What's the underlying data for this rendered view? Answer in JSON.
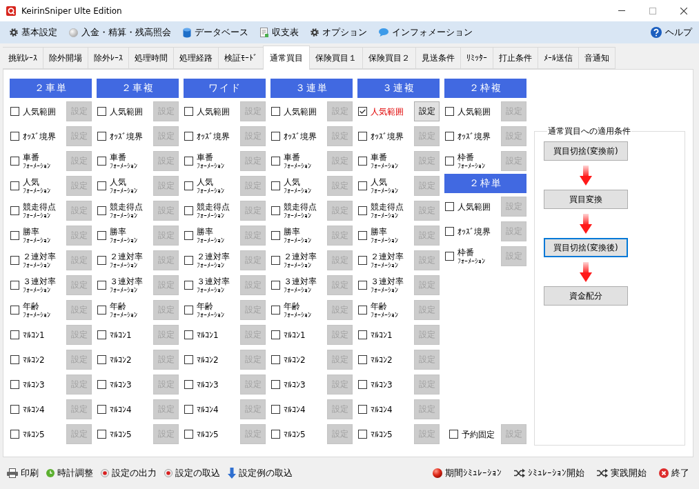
{
  "window": {
    "title": "KeirinSniper Ulte Edition"
  },
  "menu": [
    {
      "label": "基本設定"
    },
    {
      "label": "入金・精算・残高照会"
    },
    {
      "label": "データベース"
    },
    {
      "label": "収支表"
    },
    {
      "label": "オプション"
    },
    {
      "label": "インフォメーション"
    }
  ],
  "help": {
    "label": "ヘルプ"
  },
  "tabs": [
    {
      "label": "挑戦ﾚｰｽ",
      "selected": false
    },
    {
      "label": "除外開場",
      "selected": false
    },
    {
      "label": "除外ﾚｰｽ",
      "selected": false
    },
    {
      "label": "処理時間",
      "selected": false
    },
    {
      "label": "処理経路",
      "selected": false
    },
    {
      "label": "検証ﾓｰﾄﾞ",
      "selected": false
    },
    {
      "label": "通常買目",
      "selected": true
    },
    {
      "label": "保険買目１",
      "selected": false
    },
    {
      "label": "保険買目２",
      "selected": false
    },
    {
      "label": "見送条件",
      "selected": false
    },
    {
      "label": "ﾘﾐｯﾀｰ",
      "selected": false
    },
    {
      "label": "打止条件",
      "selected": false
    },
    {
      "label": "ﾒｰﾙ送信",
      "selected": false
    },
    {
      "label": "音通知",
      "selected": false
    }
  ],
  "columns": [
    {
      "sections": [
        {
          "header": "２車単",
          "rows": [
            {
              "label": "人気範囲",
              "checked": false,
              "button": "設定"
            },
            {
              "label": "ｵｯｽﾞ境界",
              "checked": false,
              "button": "設定"
            },
            {
              "label": "車番",
              "sublabel": "ﾌｫｰﾒｰｼｮﾝ",
              "checked": false,
              "button": "設定"
            },
            {
              "label": "人気",
              "sublabel": "ﾌｫｰﾒｰｼｮﾝ",
              "checked": false,
              "button": "設定"
            },
            {
              "label": "競走得点",
              "sublabel": "ﾌｫｰﾒｰｼｮﾝ",
              "checked": false,
              "button": "設定"
            },
            {
              "label": "勝率",
              "sublabel": "ﾌｫｰﾒｰｼｮﾝ",
              "checked": false,
              "button": "設定"
            },
            {
              "label": "２連対率",
              "sublabel": "ﾌｫｰﾒｰｼｮﾝ",
              "checked": false,
              "button": "設定"
            },
            {
              "label": "３連対率",
              "sublabel": "ﾌｫｰﾒｰｼｮﾝ",
              "checked": false,
              "button": "設定"
            },
            {
              "label": "年齢",
              "sublabel": "ﾌｫｰﾒｰｼｮﾝ",
              "checked": false,
              "button": "設定"
            },
            {
              "label": "ﾏﾙｺﾝ1",
              "checked": false,
              "button": "設定"
            },
            {
              "label": "ﾏﾙｺﾝ2",
              "checked": false,
              "button": "設定"
            },
            {
              "label": "ﾏﾙｺﾝ3",
              "checked": false,
              "button": "設定"
            },
            {
              "label": "ﾏﾙｺﾝ4",
              "checked": false,
              "button": "設定"
            },
            {
              "label": "ﾏﾙｺﾝ5",
              "checked": false,
              "button": "設定"
            }
          ]
        }
      ]
    },
    {
      "sections": [
        {
          "header": "２車複",
          "rows": [
            {
              "label": "人気範囲",
              "checked": false,
              "button": "設定"
            },
            {
              "label": "ｵｯｽﾞ境界",
              "checked": false,
              "button": "設定"
            },
            {
              "label": "車番",
              "sublabel": "ﾌｫｰﾒｰｼｮﾝ",
              "checked": false,
              "button": "設定"
            },
            {
              "label": "人気",
              "sublabel": "ﾌｫｰﾒｰｼｮﾝ",
              "checked": false,
              "button": "設定"
            },
            {
              "label": "競走得点",
              "sublabel": "ﾌｫｰﾒｰｼｮﾝ",
              "checked": false,
              "button": "設定"
            },
            {
              "label": "勝率",
              "sublabel": "ﾌｫｰﾒｰｼｮﾝ",
              "checked": false,
              "button": "設定"
            },
            {
              "label": "２連対率",
              "sublabel": "ﾌｫｰﾒｰｼｮﾝ",
              "checked": false,
              "button": "設定"
            },
            {
              "label": "３連対率",
              "sublabel": "ﾌｫｰﾒｰｼｮﾝ",
              "checked": false,
              "button": "設定"
            },
            {
              "label": "年齢",
              "sublabel": "ﾌｫｰﾒｰｼｮﾝ",
              "checked": false,
              "button": "設定"
            },
            {
              "label": "ﾏﾙｺﾝ1",
              "checked": false,
              "button": "設定"
            },
            {
              "label": "ﾏﾙｺﾝ2",
              "checked": false,
              "button": "設定"
            },
            {
              "label": "ﾏﾙｺﾝ3",
              "checked": false,
              "button": "設定"
            },
            {
              "label": "ﾏﾙｺﾝ4",
              "checked": false,
              "button": "設定"
            },
            {
              "label": "ﾏﾙｺﾝ5",
              "checked": false,
              "button": "設定"
            }
          ]
        }
      ]
    },
    {
      "sections": [
        {
          "header": "ワイド",
          "rows": [
            {
              "label": "人気範囲",
              "checked": false,
              "button": "設定"
            },
            {
              "label": "ｵｯｽﾞ境界",
              "checked": false,
              "button": "設定"
            },
            {
              "label": "車番",
              "sublabel": "ﾌｫｰﾒｰｼｮﾝ",
              "checked": false,
              "button": "設定"
            },
            {
              "label": "人気",
              "sublabel": "ﾌｫｰﾒｰｼｮﾝ",
              "checked": false,
              "button": "設定"
            },
            {
              "label": "競走得点",
              "sublabel": "ﾌｫｰﾒｰｼｮﾝ",
              "checked": false,
              "button": "設定"
            },
            {
              "label": "勝率",
              "sublabel": "ﾌｫｰﾒｰｼｮﾝ",
              "checked": false,
              "button": "設定"
            },
            {
              "label": "２連対率",
              "sublabel": "ﾌｫｰﾒｰｼｮﾝ",
              "checked": false,
              "button": "設定"
            },
            {
              "label": "３連対率",
              "sublabel": "ﾌｫｰﾒｰｼｮﾝ",
              "checked": false,
              "button": "設定"
            },
            {
              "label": "年齢",
              "sublabel": "ﾌｫｰﾒｰｼｮﾝ",
              "checked": false,
              "button": "設定"
            },
            {
              "label": "ﾏﾙｺﾝ1",
              "checked": false,
              "button": "設定"
            },
            {
              "label": "ﾏﾙｺﾝ2",
              "checked": false,
              "button": "設定"
            },
            {
              "label": "ﾏﾙｺﾝ3",
              "checked": false,
              "button": "設定"
            },
            {
              "label": "ﾏﾙｺﾝ4",
              "checked": false,
              "button": "設定"
            },
            {
              "label": "ﾏﾙｺﾝ5",
              "checked": false,
              "button": "設定"
            }
          ]
        }
      ]
    },
    {
      "sections": [
        {
          "header": "３連単",
          "rows": [
            {
              "label": "人気範囲",
              "checked": false,
              "button": "設定"
            },
            {
              "label": "ｵｯｽﾞ境界",
              "checked": false,
              "button": "設定"
            },
            {
              "label": "車番",
              "sublabel": "ﾌｫｰﾒｰｼｮﾝ",
              "checked": false,
              "button": "設定"
            },
            {
              "label": "人気",
              "sublabel": "ﾌｫｰﾒｰｼｮﾝ",
              "checked": false,
              "button": "設定"
            },
            {
              "label": "競走得点",
              "sublabel": "ﾌｫｰﾒｰｼｮﾝ",
              "checked": false,
              "button": "設定"
            },
            {
              "label": "勝率",
              "sublabel": "ﾌｫｰﾒｰｼｮﾝ",
              "checked": false,
              "button": "設定"
            },
            {
              "label": "２連対率",
              "sublabel": "ﾌｫｰﾒｰｼｮﾝ",
              "checked": false,
              "button": "設定"
            },
            {
              "label": "３連対率",
              "sublabel": "ﾌｫｰﾒｰｼｮﾝ",
              "checked": false,
              "button": "設定"
            },
            {
              "label": "年齢",
              "sublabel": "ﾌｫｰﾒｰｼｮﾝ",
              "checked": false,
              "button": "設定"
            },
            {
              "label": "ﾏﾙｺﾝ1",
              "checked": false,
              "button": "設定"
            },
            {
              "label": "ﾏﾙｺﾝ2",
              "checked": false,
              "button": "設定"
            },
            {
              "label": "ﾏﾙｺﾝ3",
              "checked": false,
              "button": "設定"
            },
            {
              "label": "ﾏﾙｺﾝ4",
              "checked": false,
              "button": "設定"
            },
            {
              "label": "ﾏﾙｺﾝ5",
              "checked": false,
              "button": "設定"
            }
          ]
        }
      ]
    },
    {
      "sections": [
        {
          "header": "３連複",
          "rows": [
            {
              "label": "人気範囲",
              "checked": true,
              "button": "設定"
            },
            {
              "label": "ｵｯｽﾞ境界",
              "checked": false,
              "button": "設定"
            },
            {
              "label": "車番",
              "sublabel": "ﾌｫｰﾒｰｼｮﾝ",
              "checked": false,
              "button": "設定"
            },
            {
              "label": "人気",
              "sublabel": "ﾌｫｰﾒｰｼｮﾝ",
              "checked": false,
              "button": "設定"
            },
            {
              "label": "競走得点",
              "sublabel": "ﾌｫｰﾒｰｼｮﾝ",
              "checked": false,
              "button": "設定"
            },
            {
              "label": "勝率",
              "sublabel": "ﾌｫｰﾒｰｼｮﾝ",
              "checked": false,
              "button": "設定"
            },
            {
              "label": "２連対率",
              "sublabel": "ﾌｫｰﾒｰｼｮﾝ",
              "checked": false,
              "button": "設定"
            },
            {
              "label": "３連対率",
              "sublabel": "ﾌｫｰﾒｰｼｮﾝ",
              "checked": false,
              "button": "設定"
            },
            {
              "label": "年齢",
              "sublabel": "ﾌｫｰﾒｰｼｮﾝ",
              "checked": false,
              "button": "設定"
            },
            {
              "label": "ﾏﾙｺﾝ1",
              "checked": false,
              "button": "設定"
            },
            {
              "label": "ﾏﾙｺﾝ2",
              "checked": false,
              "button": "設定"
            },
            {
              "label": "ﾏﾙｺﾝ3",
              "checked": false,
              "button": "設定"
            },
            {
              "label": "ﾏﾙｺﾝ4",
              "checked": false,
              "button": "設定"
            },
            {
              "label": "ﾏﾙｺﾝ5",
              "checked": false,
              "button": "設定"
            }
          ]
        }
      ]
    },
    {
      "sections": [
        {
          "header": "２枠複",
          "rows": [
            {
              "label": "人気範囲",
              "checked": false,
              "button": "設定"
            },
            {
              "label": "ｵｯｽﾞ境界",
              "checked": false,
              "button": "設定"
            },
            {
              "label": "枠番",
              "sublabel": "ﾌｫｰﾒｰｼｮﾝ",
              "checked": false,
              "button": "設定"
            }
          ]
        },
        {
          "header": "２枠単",
          "rows": [
            {
              "label": "人気範囲",
              "checked": false,
              "button": "設定"
            },
            {
              "label": "ｵｯｽﾞ境界",
              "checked": false,
              "button": "設定"
            },
            {
              "label": "枠番",
              "sublabel": "ﾌｫｰﾒｰｼｮﾝ",
              "checked": false,
              "button": "設定"
            }
          ]
        }
      ],
      "footer_row": {
        "label": "予約固定",
        "checked": false,
        "button": "設定"
      }
    }
  ],
  "conditions": {
    "title": "通常買目への適用条件",
    "steps": [
      {
        "label": "買目切捨(変換前)",
        "focused": false
      },
      {
        "label": "買目変換",
        "focused": false
      },
      {
        "label": "買目切捨(変換後)",
        "focused": true
      },
      {
        "label": "資金配分",
        "focused": false
      }
    ]
  },
  "toolbar_left": [
    {
      "label": "印刷"
    },
    {
      "label": "時計調整"
    },
    {
      "label": "設定の出力"
    },
    {
      "label": "設定の取込"
    },
    {
      "label": "設定例の取込"
    }
  ],
  "toolbar_right": [
    {
      "label": "期間ｼﾐｭﾚｰｼｮﾝ"
    },
    {
      "label": "ｼﾐｭﾚｰｼｮﾝ開始"
    },
    {
      "label": "実践開始"
    },
    {
      "label": "終了"
    }
  ]
}
